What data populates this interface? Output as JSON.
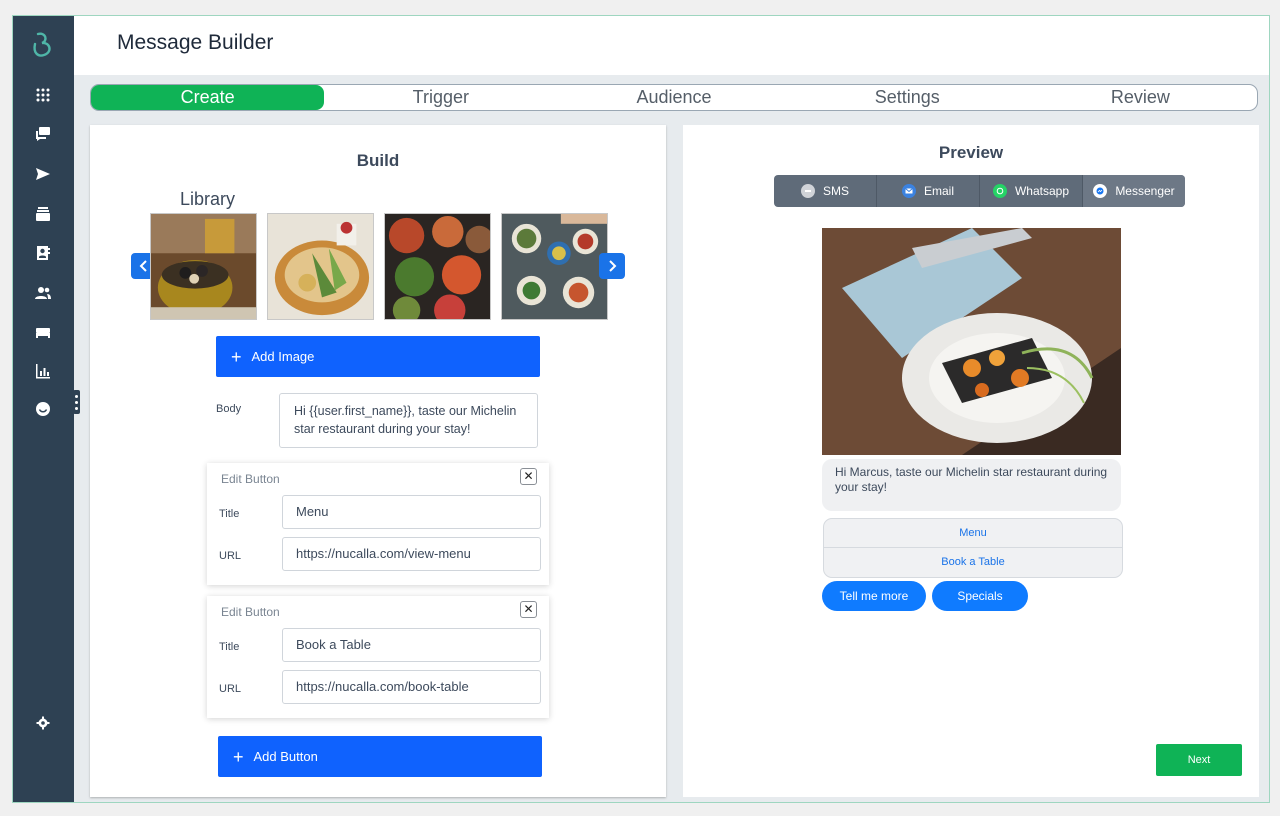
{
  "header": {
    "title": "Message Builder"
  },
  "steps": [
    "Create",
    "Trigger",
    "Audience",
    "Settings",
    "Review"
  ],
  "active_step": "Create",
  "sidebar": {
    "icons": [
      "apps-grid-icon",
      "messages-icon",
      "send-icon",
      "inbox-icon",
      "contacts-icon",
      "users-icon",
      "bed-icon",
      "analytics-icon",
      "smiley-icon",
      "settings-icon"
    ]
  },
  "build": {
    "title": "Build",
    "library_label": "Library",
    "add_image_label": "Add Image",
    "body_label": "Body",
    "body_text": "Hi {{user.first_name}}, taste our Michelin star restaurant during your stay!",
    "edit_buttons": [
      {
        "header": "Edit Button",
        "title_label": "Title",
        "title_value": "Menu",
        "url_label": "URL",
        "url_value": "https://nucalla.com/view-menu"
      },
      {
        "header": "Edit Button",
        "title_label": "Title",
        "title_value": "Book a Table",
        "url_label": "URL",
        "url_value": "https://nucalla.com/book-table"
      }
    ],
    "add_button_label": "Add Button"
  },
  "preview": {
    "title": "Preview",
    "channels": [
      {
        "label": "SMS",
        "icon": "sms-icon",
        "color": "#d0d3d8"
      },
      {
        "label": "Email",
        "icon": "email-icon",
        "color": "#3b82e0"
      },
      {
        "label": "Whatsapp",
        "icon": "whatsapp-icon",
        "color": "#25d366"
      },
      {
        "label": "Messenger",
        "icon": "messenger-icon",
        "color": "#1877f2"
      }
    ],
    "message": "Hi Marcus, taste our Michelin star restaurant during your stay!",
    "buttons": [
      "Menu",
      "Book a Table"
    ],
    "quick_replies": [
      "Tell me more",
      "Specials"
    ],
    "next_label": "Next"
  },
  "colors": {
    "accent": "#0fb356",
    "primary": "#0f62fe",
    "sidebar": "#2e4153"
  }
}
